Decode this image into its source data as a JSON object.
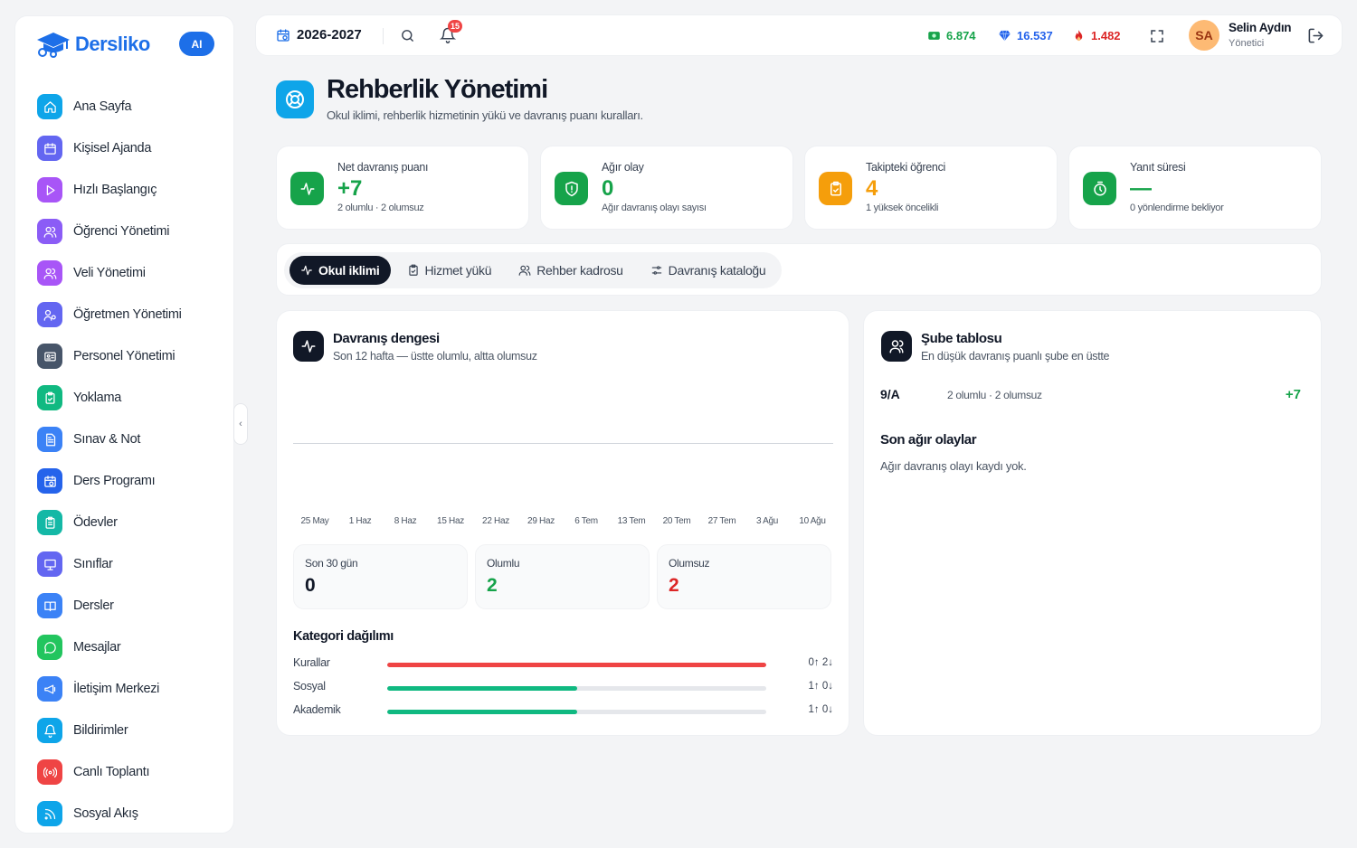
{
  "brand": {
    "name": "Dersliko",
    "ai_label": "AI"
  },
  "sidebar": {
    "items": [
      {
        "label": "Ana Sayfa",
        "icon": "home-icon",
        "color": "#0ea5e9"
      },
      {
        "label": "Kişisel Ajanda",
        "icon": "calendar-icon",
        "color": "#6366f1"
      },
      {
        "label": "Hızlı Başlangıç",
        "icon": "play-icon",
        "color": "#a855f7"
      },
      {
        "label": "Öğrenci Yönetimi",
        "icon": "users-icon",
        "color": "#8b5cf6"
      },
      {
        "label": "Veli Yönetimi",
        "icon": "users-icon",
        "color": "#a855f7"
      },
      {
        "label": "Öğretmen Yönetimi",
        "icon": "teacher-icon",
        "color": "#6366f1"
      },
      {
        "label": "Personel Yönetimi",
        "icon": "id-card-icon",
        "color": "#475569"
      },
      {
        "label": "Yoklama",
        "icon": "clipboard-icon",
        "color": "#10b981"
      },
      {
        "label": "Sınav & Not",
        "icon": "document-icon",
        "color": "#3b82f6"
      },
      {
        "label": "Ders Programı",
        "icon": "calendar-clock-icon",
        "color": "#2563eb"
      },
      {
        "label": "Ödevler",
        "icon": "clipboard-list-icon",
        "color": "#14b8a6"
      },
      {
        "label": "Sınıflar",
        "icon": "presentation-icon",
        "color": "#6366f1"
      },
      {
        "label": "Dersler",
        "icon": "book-icon",
        "color": "#3b82f6"
      },
      {
        "label": "Mesajlar",
        "icon": "message-icon",
        "color": "#22c55e"
      },
      {
        "label": "İletişim Merkezi",
        "icon": "megaphone-icon",
        "color": "#3b82f6"
      },
      {
        "label": "Bildirimler",
        "icon": "bell-icon",
        "color": "#0ea5e9"
      },
      {
        "label": "Canlı Toplantı",
        "icon": "broadcast-icon",
        "color": "#ef4444"
      },
      {
        "label": "Sosyal Akış",
        "icon": "rss-icon",
        "color": "#0ea5e9"
      }
    ]
  },
  "topbar": {
    "year": "2026-2027",
    "notification_count": "15",
    "stats": [
      {
        "value": "6.874",
        "icon": "money-icon",
        "color": "#16a34a"
      },
      {
        "value": "16.537",
        "icon": "gem-icon",
        "color": "#2563eb"
      },
      {
        "value": "1.482",
        "icon": "fire-icon",
        "color": "#dc2626"
      }
    ],
    "user": {
      "initials": "SA",
      "name": "Selin Aydın",
      "role": "Yönetici"
    }
  },
  "page": {
    "title": "Rehberlik Yönetimi",
    "subtitle": "Okul iklimi, rehberlik hizmetinin yükü ve davranış puanı kuralları."
  },
  "kpis": [
    {
      "label": "Net davranış puanı",
      "value": "+7",
      "note": "2 olumlu · 2 olumsuz",
      "color": "#16a34a",
      "icon": "activity-icon"
    },
    {
      "label": "Ağır olay",
      "value": "0",
      "note": "Ağır davranış olayı sayısı",
      "color": "#16a34a",
      "icon": "shield-icon"
    },
    {
      "label": "Takipteki öğrenci",
      "value": "4",
      "note": "1 yüksek öncelikli",
      "color": "#f59e0b",
      "icon": "clipboard-icon"
    },
    {
      "label": "Yanıt süresi",
      "value": "—",
      "note": "0 yönlendirme bekliyor",
      "color": "#16a34a",
      "icon": "timer-icon"
    }
  ],
  "tabs": [
    {
      "label": "Okul iklimi",
      "icon": "activity-icon",
      "active": true
    },
    {
      "label": "Hizmet yükü",
      "icon": "clipboard-icon",
      "active": false
    },
    {
      "label": "Rehber kadrosu",
      "icon": "users-icon",
      "active": false
    },
    {
      "label": "Davranış kataloğu",
      "icon": "sliders-icon",
      "active": false
    }
  ],
  "balance": {
    "title": "Davranış dengesi",
    "subtitle": "Son 12 hafta — üstte olumlu, altta olumsuz",
    "stats": [
      {
        "label": "Son 30 gün",
        "value": "0",
        "color": "#111827"
      },
      {
        "label": "Olumlu",
        "value": "2",
        "color": "#16a34a"
      },
      {
        "label": "Olumsuz",
        "value": "2",
        "color": "#dc2626"
      }
    ],
    "category_title": "Kategori dağılımı",
    "categories": [
      {
        "name": "Kurallar",
        "positive": 0,
        "negative": 2,
        "share": 1.0,
        "color": "#ef4444",
        "counts": "0↑ 2↓"
      },
      {
        "name": "Sosyal",
        "positive": 1,
        "negative": 0,
        "share": 0.5,
        "color": "#10b981",
        "counts": "1↑ 0↓"
      },
      {
        "name": "Akademik",
        "positive": 1,
        "negative": 0,
        "share": 0.5,
        "color": "#10b981",
        "counts": "1↑ 0↓"
      }
    ]
  },
  "chart_data": {
    "type": "bar",
    "categories": [
      "25 May",
      "1 Haz",
      "8 Haz",
      "15 Haz",
      "22 Haz",
      "29 Haz",
      "6 Tem",
      "13 Tem",
      "20 Tem",
      "27 Tem",
      "3 Ağu",
      "10 Ağu"
    ],
    "series": [],
    "grid": false
  },
  "branch": {
    "title": "Şube tablosu",
    "subtitle": "En düşük davranış puanlı şube en üstte",
    "rows": [
      {
        "name": "9/A",
        "note": "2 olumlu · 2 olumsuz",
        "score": "+7"
      }
    ],
    "severe_title": "Son ağır olaylar",
    "severe_empty": "Ağır davranış olayı kaydı yok."
  }
}
